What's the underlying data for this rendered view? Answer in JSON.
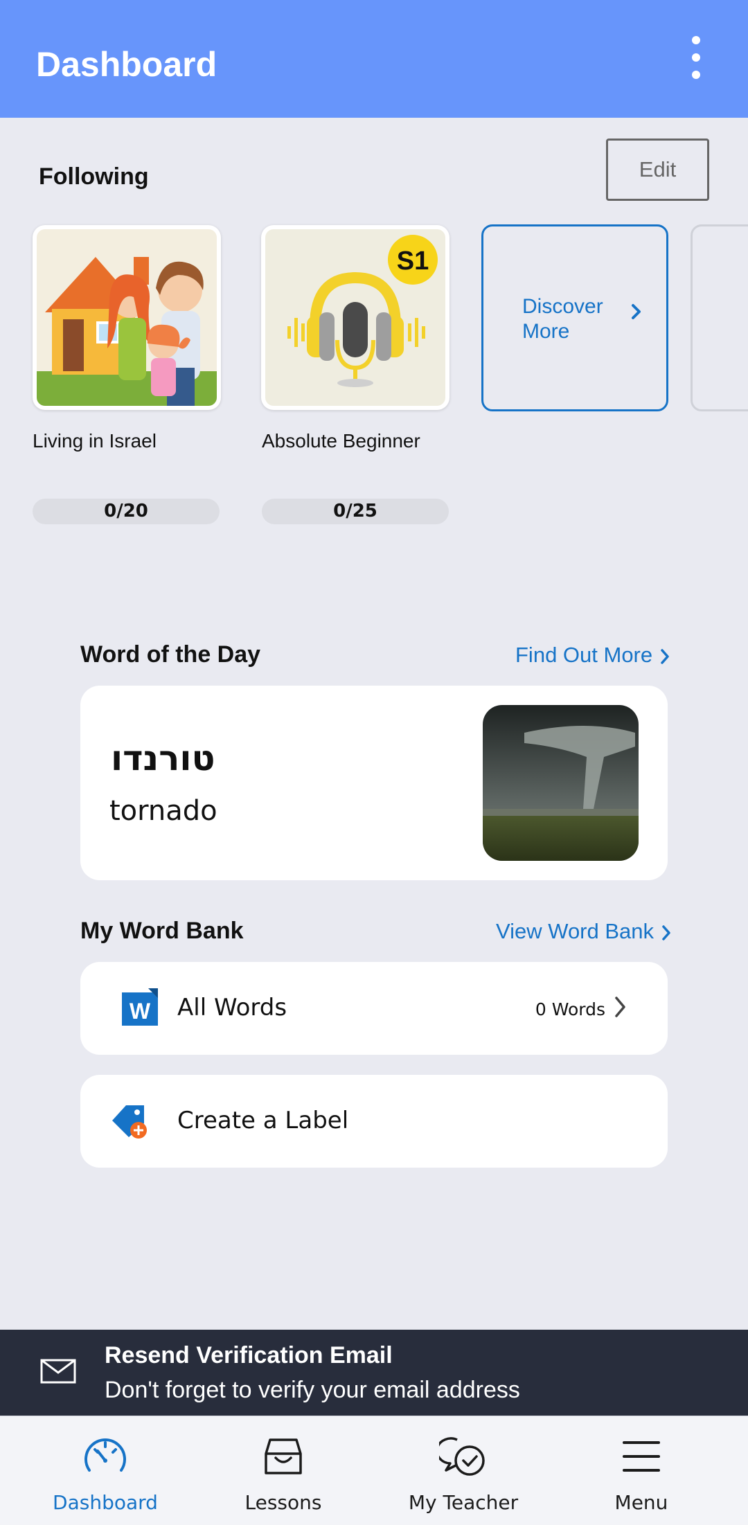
{
  "header": {
    "title": "Dashboard",
    "menu_icon": "more-vertical-icon"
  },
  "following": {
    "title": "Following",
    "edit_label": "Edit",
    "courses": [
      {
        "name": "Living in Israel",
        "progress": "0/20",
        "image": "family-house-illustration"
      },
      {
        "name": "Absolute Beginner",
        "progress": "0/25",
        "image": "headphones-microphone-illustration",
        "badge": "S1"
      }
    ],
    "discover": {
      "label": "Discover More",
      "icon": "chevron-right-icon"
    }
  },
  "word_of_day": {
    "title": "Word of the Day",
    "link": "Find Out More",
    "word": "טורנדו",
    "translation": "tornado",
    "image": "tornado-photo"
  },
  "word_bank": {
    "title": "My Word Bank",
    "link": "View Word Bank",
    "all_words": {
      "label": "All Words",
      "count": "0 Words",
      "icon": "word-list-icon"
    },
    "create_label": {
      "label": "Create a Label",
      "icon": "add-tag-icon"
    }
  },
  "banner": {
    "title": "Resend Verification Email",
    "subtitle": "Don't forget to verify your email address",
    "icon": "mail-icon"
  },
  "tabs": [
    {
      "label": "Dashboard",
      "icon": "speedometer-icon",
      "active": true
    },
    {
      "label": "Lessons",
      "icon": "inbox-icon",
      "active": false
    },
    {
      "label": "My Teacher",
      "icon": "chat-check-icon",
      "active": false
    },
    {
      "label": "Menu",
      "icon": "hamburger-icon",
      "active": false
    }
  ],
  "colors": {
    "header": "#6795fb",
    "accent": "#1673c7",
    "background": "#e9eaf1",
    "banner": "#282d3c"
  }
}
